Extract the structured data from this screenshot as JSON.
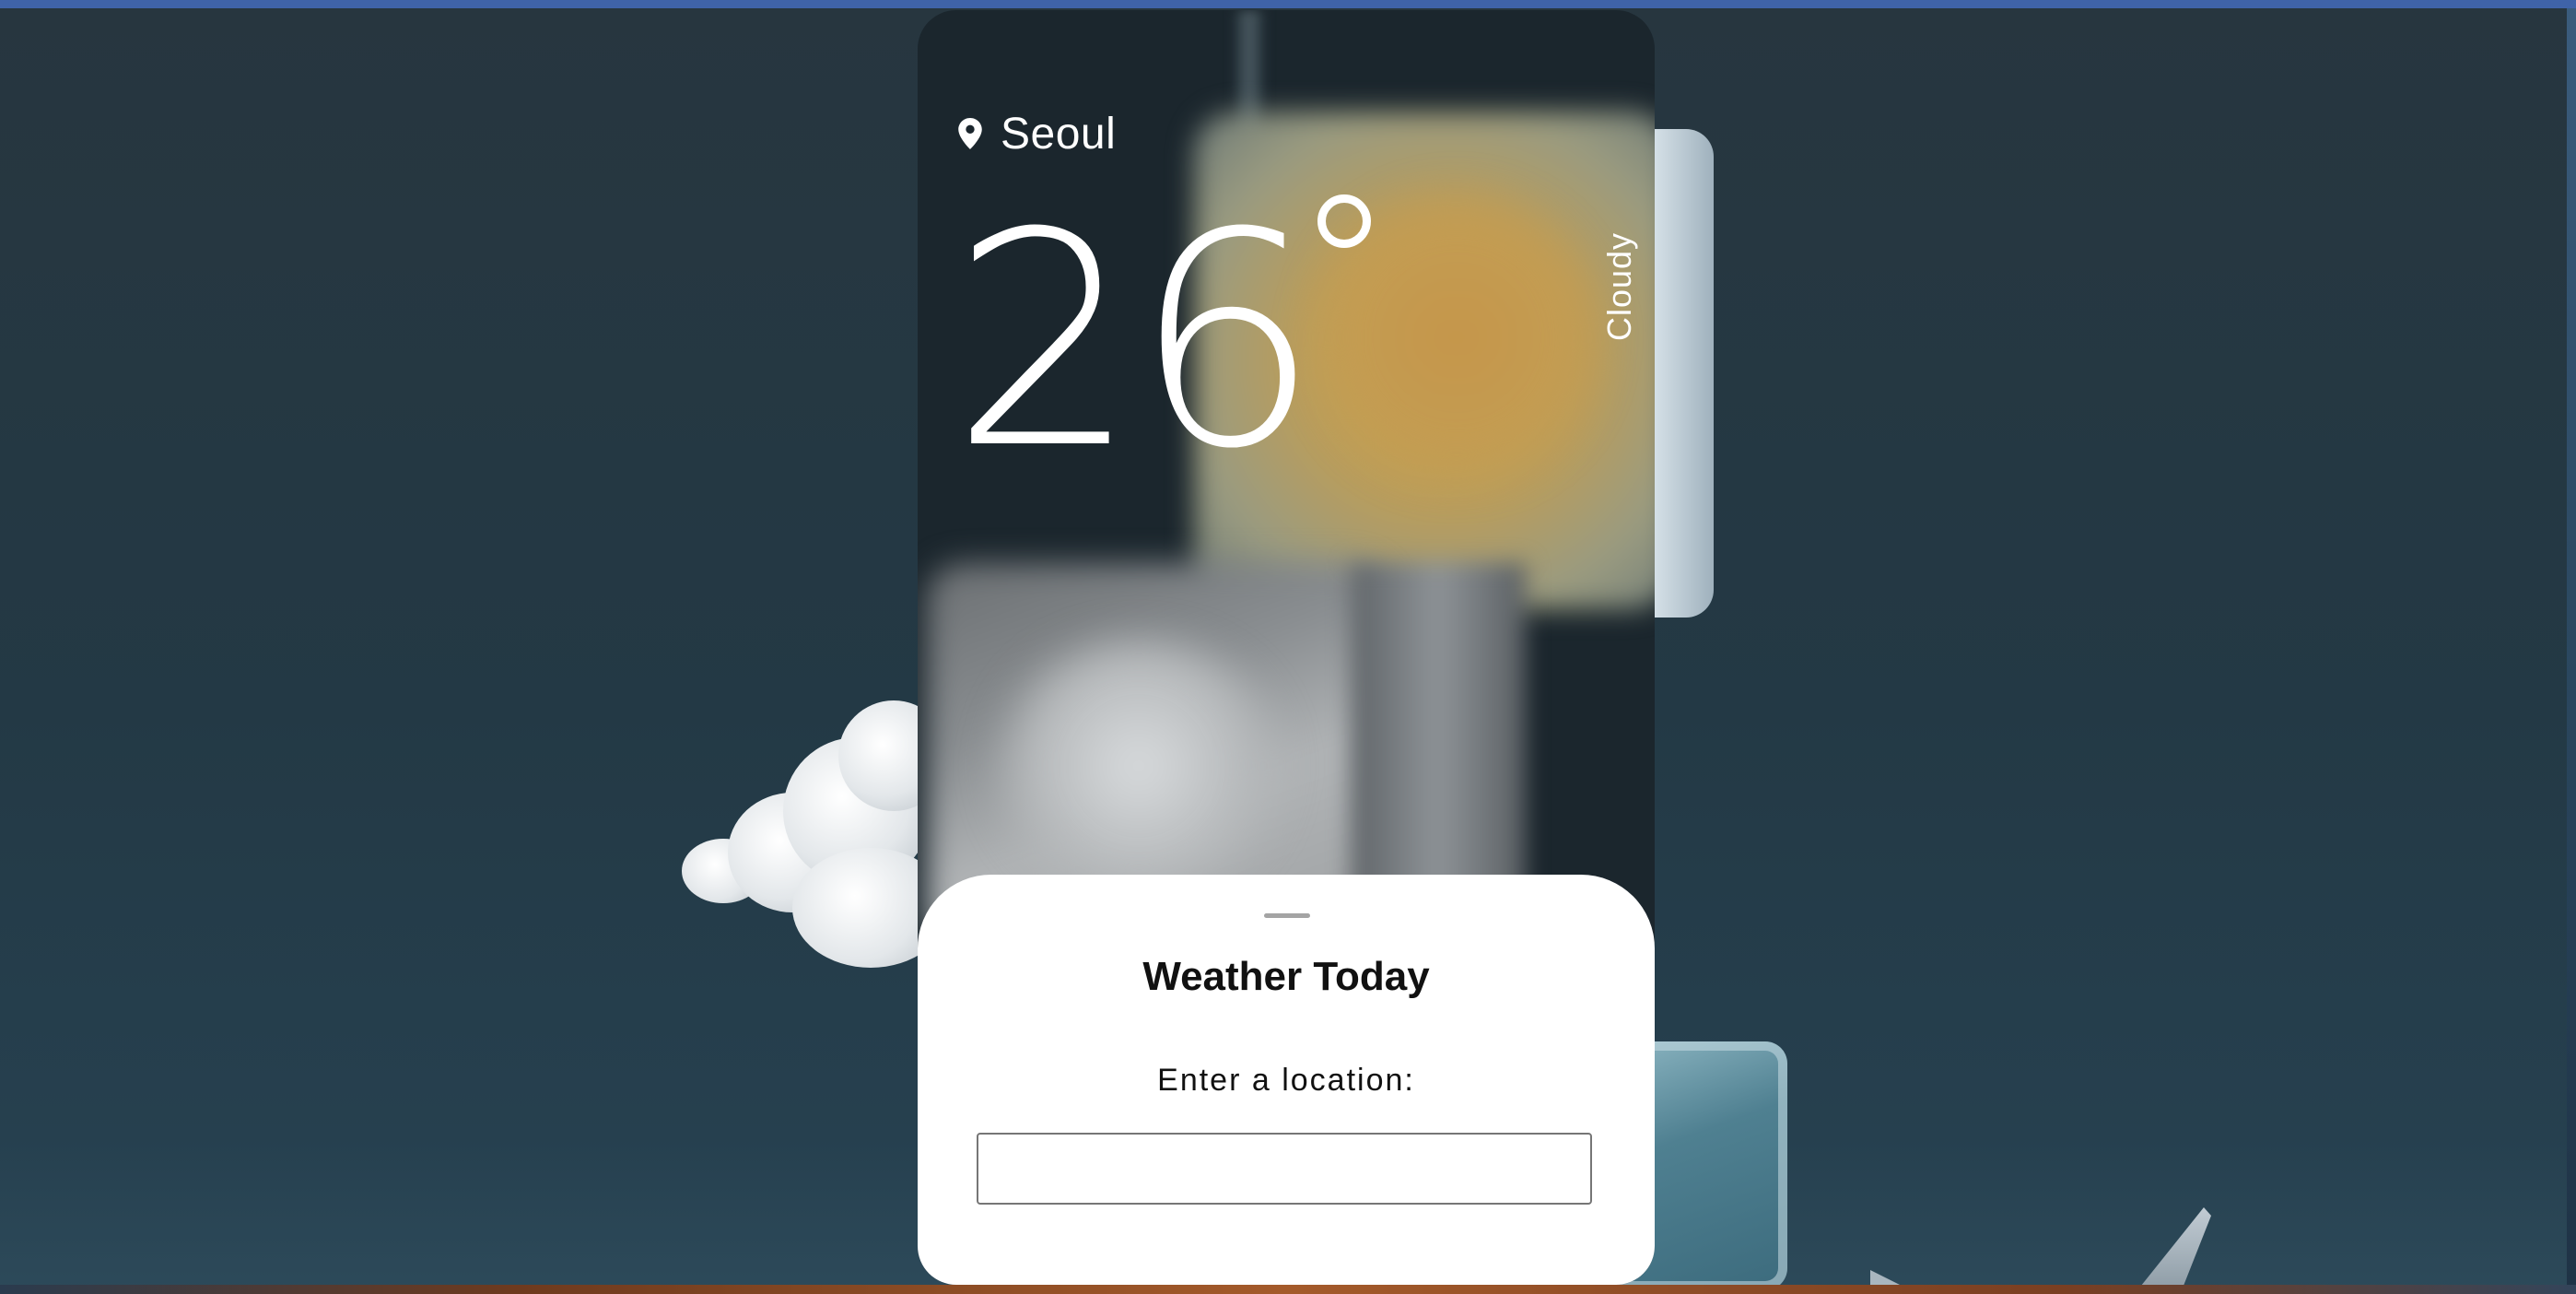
{
  "weather": {
    "location": "Seoul",
    "temperature": "26",
    "condition": "Cloudy"
  },
  "sheet": {
    "title": "Weather Today",
    "input_label": "Enter a location:",
    "input_value": "",
    "input_placeholder": ""
  },
  "icons": {
    "location": "map-pin-icon"
  },
  "colors": {
    "background": "#233945",
    "card": "#1b262d",
    "sheet": "#ffffff",
    "text_on_card": "#ffffff",
    "sheet_text": "#111111",
    "sun": "#d1a548"
  }
}
